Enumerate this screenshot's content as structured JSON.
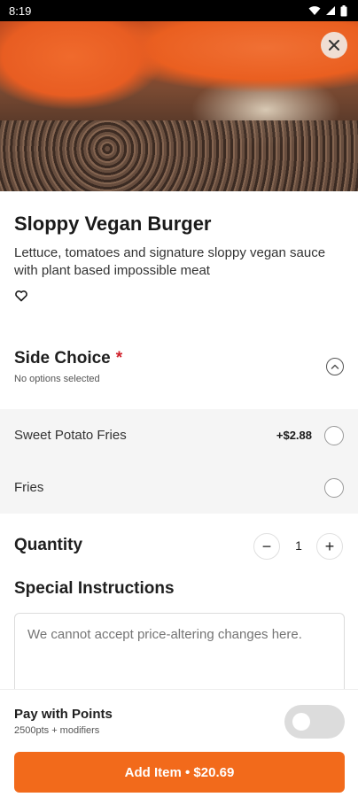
{
  "status_bar": {
    "time": "8:19"
  },
  "item": {
    "title": "Sloppy Vegan Burger",
    "description": "Lettuce, tomatoes and signature sloppy vegan sauce with plant based impossible meat"
  },
  "side_choice": {
    "heading": "Side Choice",
    "required_mark": "*",
    "subtext": "No options selected",
    "options": [
      {
        "label": "Sweet Potato Fries",
        "price": "+$2.88",
        "selected": false
      },
      {
        "label": "Fries",
        "price": "",
        "selected": false
      }
    ]
  },
  "quantity": {
    "label": "Quantity",
    "value": "1",
    "minus": "−",
    "plus": "+"
  },
  "special_instructions": {
    "label": "Special Instructions",
    "placeholder": "We cannot accept price-altering changes here."
  },
  "points": {
    "label": "Pay with Points",
    "subtext": "2500pts + modifiers",
    "enabled": false
  },
  "add_button": {
    "label": "Add Item • $20.69"
  },
  "colors": {
    "accent": "#f26a1b",
    "required": "#d0212b",
    "option_bg": "#f5f5f5"
  }
}
